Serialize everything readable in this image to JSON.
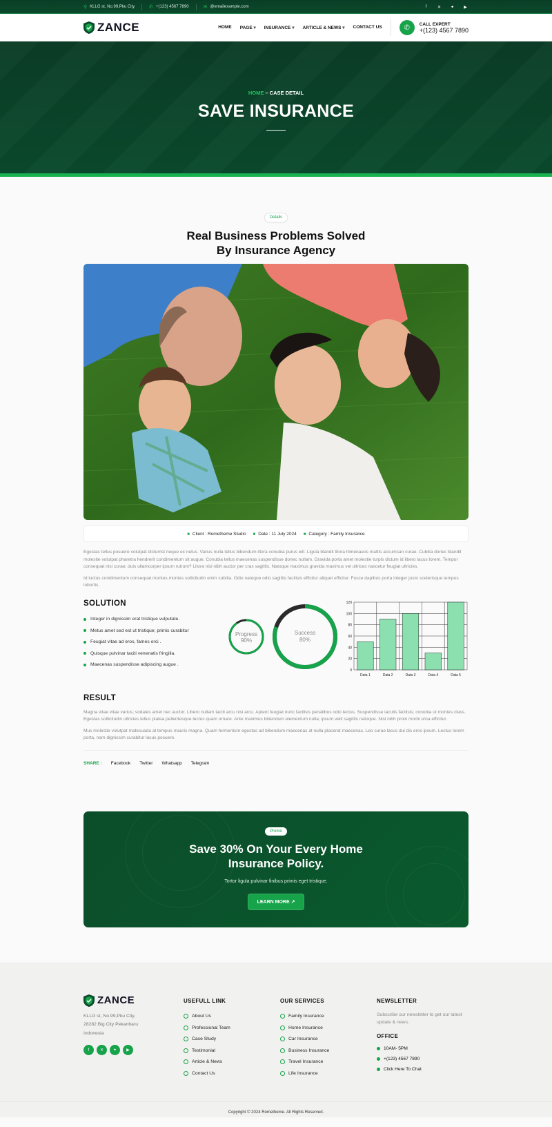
{
  "topbar": {
    "address": "KLLG st, No.99,Pku City",
    "phone": "+(123) 4567 7890",
    "email": "@emailexample.com",
    "socials": [
      "facebook-icon",
      "x-icon",
      "twitter-icon",
      "youtube-icon"
    ]
  },
  "header": {
    "logo": "ZANCE",
    "nav": [
      "HOME",
      "PAGE",
      "INSURANCE",
      "ARTICLE & NEWS",
      "CONTACT US"
    ],
    "call_label": "CALL EXPERT",
    "call_number": "+(123) 4567 7890"
  },
  "hero": {
    "crumb_home": "HOME",
    "crumb_current": " – CASE DETAIL",
    "title": "SAVE INSURANCE"
  },
  "article": {
    "pill": "Details",
    "title_line1": "Real Business Problems Solved",
    "title_line2": "By Insurance Agency",
    "client": "Client : Rometheme Studio",
    "date": "Date : 11 July 2024",
    "category": "Category : Family Insurance",
    "para1": "Egestas tellus posuere volutpat dictumst neque ex netus. Varius nulla tellus bibendum litora conubia purus elit. Ligula blandit litora himenaeos mattis accumsan curae. Cubilia donec blandit molestie volutpat pharetra hendrerit condimentum sit augue. Conubia tellus maecenas suspendisse donec nullam. Gravida porta amet molestie turpis dictum id libero lacus lorem. Tempor consequat nisi curae; duis ullamcorper ipsum rutrum? Litora nisi nibh auctor per cras sagittis. Natoque maximus gravida maximus vel ultrices nascetur feugiat ultricies.",
    "para2": "Id luctus condimentum consequat montes montes sollicitudin enim cubilia. Odio natoque odio sagittis facilisis efficitur aliquet efficitur. Fusce dapibus porta integer justo scelerisque tempus lobortis.",
    "solution_title": "SOLUTION",
    "solution_items": [
      "Integer in dignissim erat tristique vulputate.",
      "Metus amet sed est ut tristique; primis curabitur",
      "Feugiat vitae ad eros, fames orci .",
      "Quisque pulvinar taciti venenatis fringilla.",
      "Maecenas suspendisse adipiscing augue ."
    ],
    "progress_label": "Progress",
    "progress_value": "90%",
    "progress_fraction": 0.9,
    "success_label": "Success",
    "success_value": "80%",
    "success_fraction": 0.8,
    "result_title": "RESULT",
    "result_para1": "Magna vitae vitae varius; sodales amet nec auctor. Libero nullam taciti arcu nisi arcu. Aptent feugiat nunc facilisis penatibus odio lectus. Suspendisse iaculis facilisis; conubia ut montes class. Egestas sollicitudin ultricies tellus platea pellentesque lectus quam ornare. Ante maximus bibendum elementum nulla; ipsum velit sagittis natoque. Nisl nibh proin morbi urna efficitur.",
    "result_para2": "Mus molestie volutpat malesuada at tempus mauris magna. Quam fermentum egestas ad bibendum maecenas at nulla placerat maecenas. Leo curae lacus dui dis eros ipsum. Lectus lorem porta, nam dignissim curabitur lacus posuere.",
    "share_label": "SHARE :",
    "share_links": [
      "Facebook",
      "Twitter",
      "Whatsapp",
      "Telegram"
    ]
  },
  "chart_data": {
    "type": "bar",
    "categories": [
      "Data 1",
      "Data 2",
      "Data 3",
      "Data 4",
      "Data 5"
    ],
    "values": [
      50,
      90,
      100,
      30,
      120
    ],
    "yticks": [
      0,
      20,
      40,
      60,
      80,
      100,
      120
    ],
    "ylim": [
      0,
      120
    ],
    "grid": true,
    "bar_color": "#8ce0b0"
  },
  "promo": {
    "pill": "Promo",
    "title_line1": "Save 30% On Your Every Home",
    "title_line2": "Insurance Policy.",
    "text": "Tortor ligula pulvinar finibus primis eget tristique.",
    "button": "LEARN MORE ↗"
  },
  "footer": {
    "logo": "ZANCE",
    "address_line1": "KLLG st, No.99,Pku City,",
    "address_line2": "28282 Big City Pekanbaru",
    "address_line3": "Indonesia",
    "socials": [
      "facebook-icon",
      "x-icon",
      "twitter-icon",
      "youtube-icon"
    ],
    "links_title": "USEFULL LINK",
    "links": [
      "About Us",
      "Professional Team",
      "Case Study",
      "Testimonial",
      "Article & News",
      "Contact Us"
    ],
    "services_title": "OUR SERVICES",
    "services": [
      "Family Insurance",
      "Home Insurance",
      "Car Insurance",
      "Business Insurance",
      "Travel Insurance",
      "Life Insurance"
    ],
    "newsletter_title": "NEWSLETTER",
    "newsletter_text": "Subscribe our newsletter to get our latest update & news.",
    "office_title": "OFFICE",
    "office_hours": "10AM- 5PM",
    "office_phone": "+(123) 4567 7890",
    "office_chat": "Click Here To Chat",
    "copyright": "Copyright © 2024 Rometheme. All Rights Reserved."
  },
  "colors": {
    "brand_green": "#16a34a",
    "dark_green": "#0b4a2c"
  }
}
